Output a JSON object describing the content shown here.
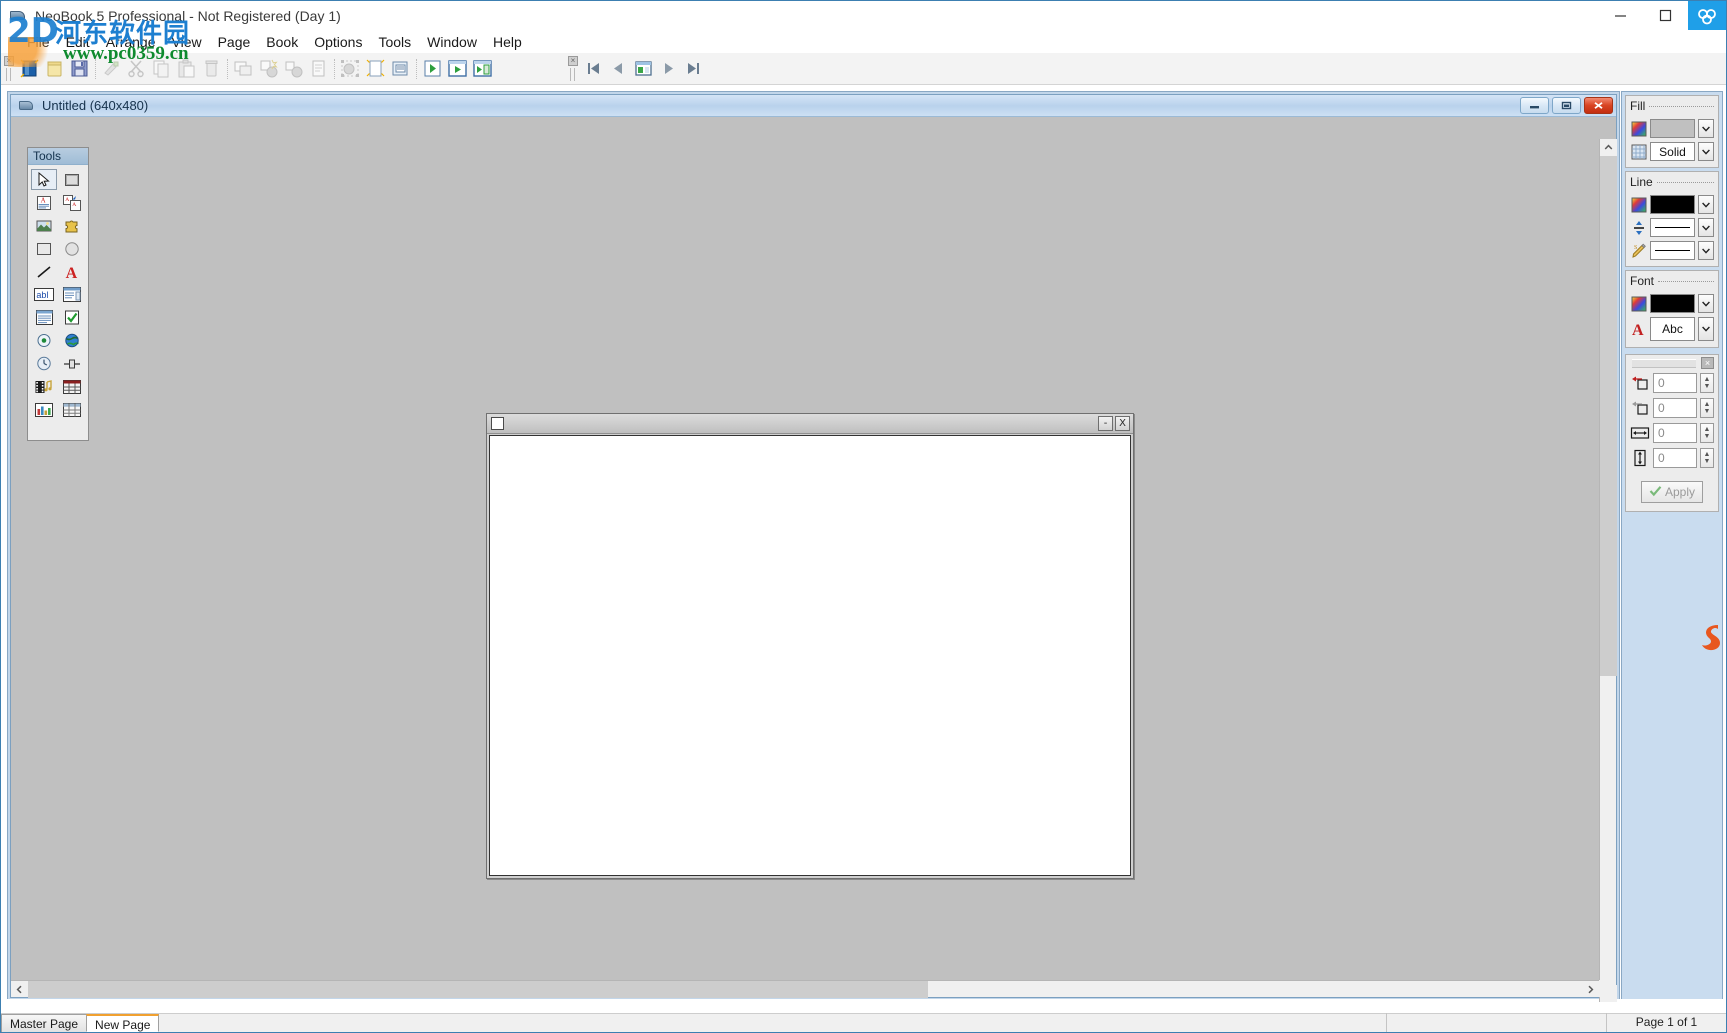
{
  "window": {
    "title": "NeoBook 5 Professional - Not Registered (Day 1)",
    "app_icon": "book-icon",
    "controls": {
      "minimize": "minimize-icon",
      "maximize": "maximize-icon",
      "brand": "brand-icon"
    }
  },
  "watermark": {
    "logo": "2D",
    "chinese": "河东软件园",
    "url": "www.pc0359.cn"
  },
  "menubar": {
    "items": [
      {
        "label": "File",
        "name": "menu-file"
      },
      {
        "label": "Edit",
        "name": "menu-edit"
      },
      {
        "label": "Arrange",
        "name": "menu-arrange"
      },
      {
        "label": "View",
        "name": "menu-view"
      },
      {
        "label": "Page",
        "name": "menu-page"
      },
      {
        "label": "Book",
        "name": "menu-book"
      },
      {
        "label": "Options",
        "name": "menu-options"
      },
      {
        "label": "Tools",
        "name": "menu-tools"
      },
      {
        "label": "Window",
        "name": "menu-window"
      },
      {
        "label": "Help",
        "name": "menu-help"
      }
    ]
  },
  "toolbar": {
    "groups": [
      {
        "buttons": [
          "new-book-icon",
          "open-book-icon",
          "save-book-icon"
        ]
      },
      {
        "buttons": [
          "format-painter-icon",
          "cut-icon",
          "copy-icon",
          "paste-icon",
          "delete-icon"
        ]
      },
      {
        "buttons": [
          "duplicate-icon",
          "group-icon",
          "ungroup-icon",
          "properties-icon"
        ]
      },
      {
        "buttons": [
          "select-all-icon",
          "new-page-icon",
          "page-properties-icon"
        ]
      },
      {
        "buttons": [
          "run-icon",
          "run-page-icon",
          "run-from-page-icon"
        ]
      }
    ],
    "nav_buttons": [
      "first-page-icon",
      "previous-page-icon",
      "page-thumb-icon",
      "next-page-icon",
      "last-page-icon"
    ]
  },
  "child_window": {
    "title": "Untitled (640x480)",
    "icon": "book-icon",
    "buttons": {
      "minimize": "minimize-icon",
      "restore": "restore-icon",
      "close": "close-icon"
    }
  },
  "tools_palette": {
    "caption": "Tools",
    "tools": [
      {
        "name": "pointer-tool",
        "icon": "arrow-cursor-icon",
        "selected": true
      },
      {
        "name": "shape-tool",
        "icon": "filled-square-icon",
        "selected": false
      },
      {
        "name": "article-tool",
        "icon": "text-article-icon",
        "selected": false
      },
      {
        "name": "linked-article-tool",
        "icon": "linked-article-icon",
        "selected": false
      },
      {
        "name": "image-tool",
        "icon": "picture-icon",
        "selected": false
      },
      {
        "name": "plugin-tool",
        "icon": "puzzle-piece-icon",
        "selected": false
      },
      {
        "name": "rectangle-tool",
        "icon": "rectangle-icon",
        "selected": false
      },
      {
        "name": "ellipse-tool",
        "icon": "ellipse-icon",
        "selected": false
      },
      {
        "name": "line-tool",
        "icon": "diagonal-line-icon",
        "selected": false
      },
      {
        "name": "text-tool",
        "icon": "letter-a-icon",
        "selected": false
      },
      {
        "name": "textentry-tool",
        "icon": "abl-textbox-icon",
        "selected": false
      },
      {
        "name": "listbox-tool",
        "icon": "listbox-icon",
        "selected": false
      },
      {
        "name": "memo-tool",
        "icon": "memo-icon",
        "selected": false
      },
      {
        "name": "checkbox-tool",
        "icon": "checkbox-icon",
        "selected": false
      },
      {
        "name": "radiobutton-tool",
        "icon": "radio-button-icon",
        "selected": false
      },
      {
        "name": "web-browser-tool",
        "icon": "globe-icon",
        "selected": false
      },
      {
        "name": "timer-tool",
        "icon": "clock-icon",
        "selected": false
      },
      {
        "name": "slider-tool",
        "icon": "slider-icon",
        "selected": false
      },
      {
        "name": "media-tool",
        "icon": "film-music-icon",
        "selected": false
      },
      {
        "name": "datagrid-tool",
        "icon": "data-grid-icon",
        "selected": false
      },
      {
        "name": "chart-tool",
        "icon": "chart-icon",
        "selected": false
      },
      {
        "name": "table-tool",
        "icon": "table-icon",
        "selected": false
      }
    ]
  },
  "page_window": {
    "sys_icon": "system-menu-icon",
    "minimize": "-",
    "close": "X"
  },
  "properties": {
    "fill": {
      "title": "Fill",
      "color_icon": "color-wheel-icon",
      "color_value": "",
      "pattern_icon": "hatch-pattern-icon",
      "pattern_value": "Solid",
      "dropdown_icon": "chevron-down-icon"
    },
    "line": {
      "title": "Line",
      "color_icon": "color-wheel-icon",
      "color_value": "",
      "width_icon": "line-width-icon",
      "width_value": "",
      "style_icon": "line-style-pencil-icon",
      "style_value": "",
      "dropdown_icon": "chevron-down-icon"
    },
    "font": {
      "title": "Font",
      "color_icon": "color-wheel-icon",
      "color_value": "",
      "face_icon": "letter-a-red-icon",
      "face_value": "Abc",
      "dropdown_icon": "chevron-down-icon"
    },
    "geometry": {
      "close_icon": "close-icon",
      "fields": [
        {
          "name": "position-left-field",
          "icon": "align-left-icon",
          "value": "0"
        },
        {
          "name": "position-top-field",
          "icon": "align-top-icon",
          "value": "0"
        },
        {
          "name": "width-field",
          "icon": "width-arrows-icon",
          "value": "0"
        },
        {
          "name": "height-field",
          "icon": "height-arrows-icon",
          "value": "0"
        }
      ],
      "apply_label": "Apply",
      "apply_icon": "check-mark-icon"
    },
    "colors": {
      "fill_swatch": "#c0c0c0",
      "line_swatch": "#000000",
      "font_swatch": "#000000",
      "accent": "#3c7fb1"
    }
  },
  "page_tabs": [
    {
      "label": "Master Page",
      "name": "tab-master-page",
      "active": false
    },
    {
      "label": "New Page",
      "name": "tab-new-page",
      "active": true
    }
  ],
  "status_bar": {
    "page_indicator": "Page 1 of 1"
  }
}
